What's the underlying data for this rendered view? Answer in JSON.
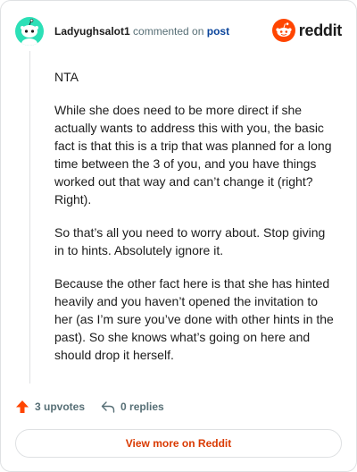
{
  "comment": {
    "username": "Ladyughsalot1",
    "commented_on": "commented on",
    "post_link": "post",
    "paragraphs": [
      "NTA",
      "While she does need to be more direct if she actually wants to address this with you, the basic fact is that this is a trip that was planned for a long time between the 3 of you, and you have things worked out that way and can’t change it (right? Right).",
      "So that’s all you need to worry about. Stop giving in to hints. Absolutely ignore it.",
      "Because the other fact here is that she has hinted heavily and you haven’t opened the invitation to her (as I’m sure you’ve done with other hints in the past). So she knows what’s going on here and should drop it herself."
    ]
  },
  "brand": {
    "name": "reddit",
    "color": "#ff4500"
  },
  "actions": {
    "upvotes": "3 upvotes",
    "replies": "0 replies"
  },
  "footer": {
    "view_more": "View more on Reddit"
  },
  "colors": {
    "accent": "#ff4500",
    "link": "#0a449b",
    "muted": "#576f76",
    "button_text": "#d93900",
    "avatar_bg": "#2ce0b7"
  },
  "icons": [
    "reddit-snoo-avatar-icon",
    "reddit-logo-icon",
    "upvote-arrow-icon",
    "reply-icon"
  ]
}
